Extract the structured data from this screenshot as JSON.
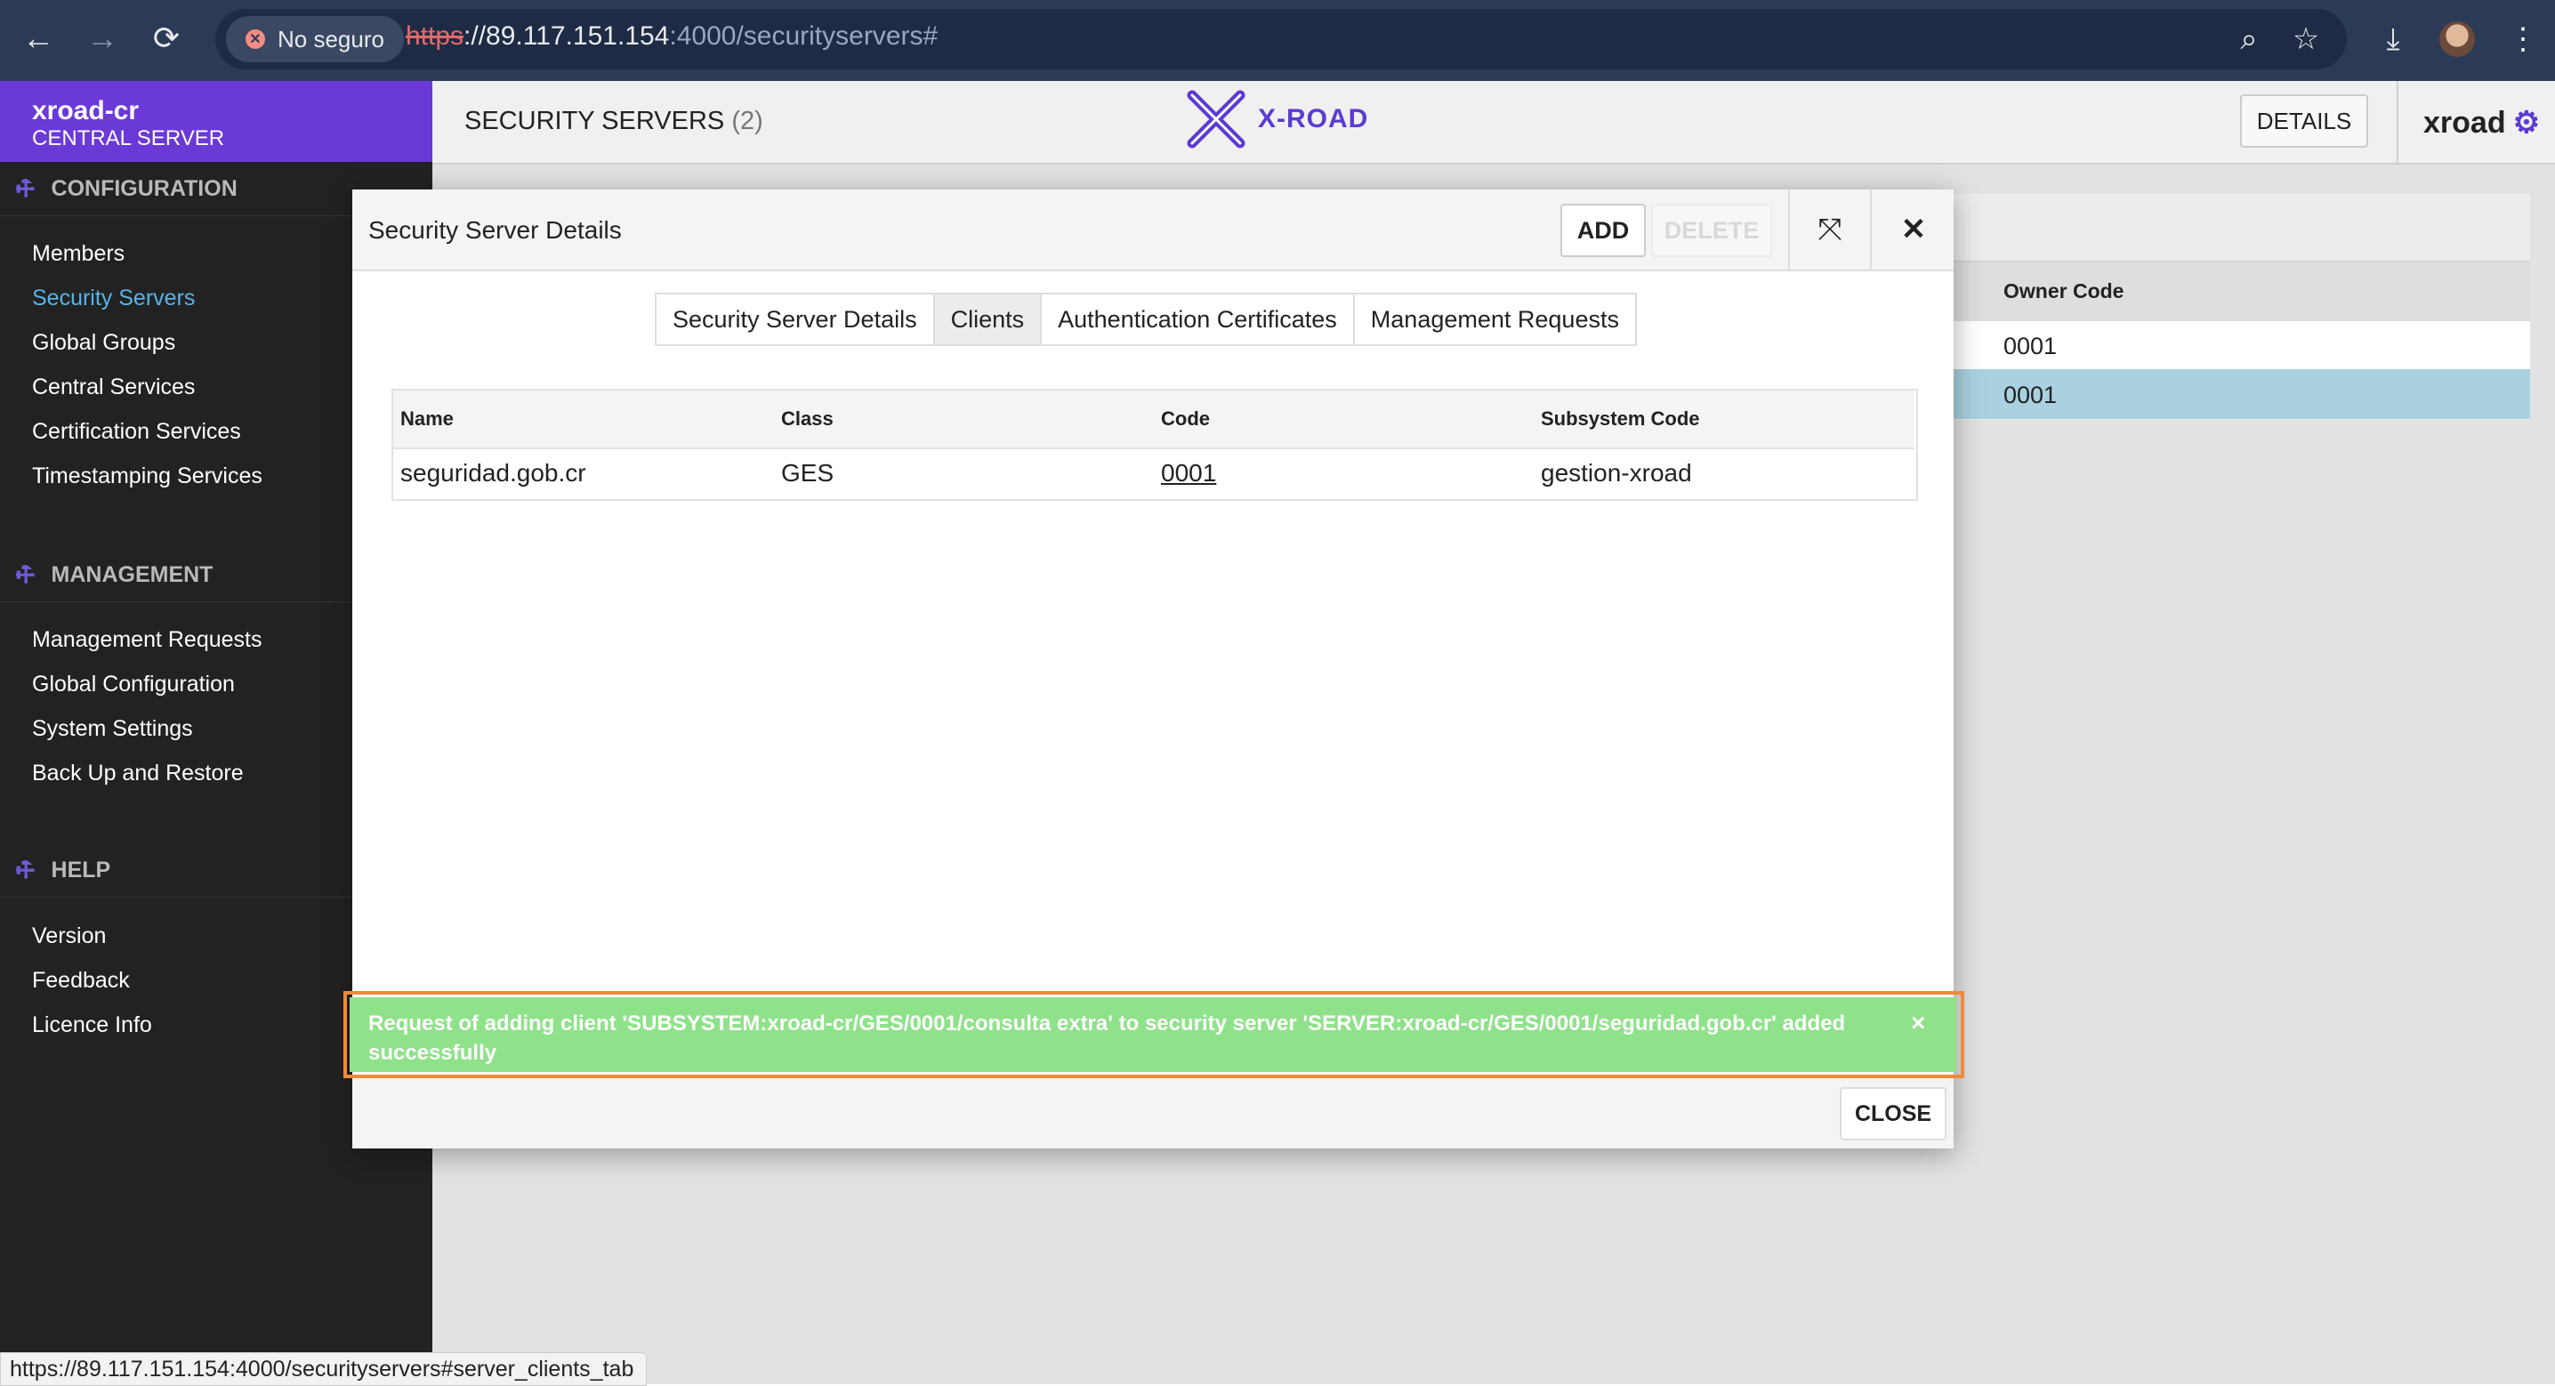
{
  "browser": {
    "security_label": "No seguro",
    "url_scheme": "https",
    "url_host": "://89.117.151.154",
    "url_rest": ":4000/securityservers#",
    "status_url": "https://89.117.151.154:4000/securityservers#server_clients_tab"
  },
  "brand": {
    "instance": "xroad-cr",
    "subtitle": "CENTRAL SERVER"
  },
  "sidebar": {
    "sections": [
      {
        "title": "CONFIGURATION",
        "items": [
          "Members",
          "Security Servers",
          "Global Groups",
          "Central Services",
          "Certification Services",
          "Timestamping Services"
        ]
      },
      {
        "title": "MANAGEMENT",
        "items": [
          "Management Requests",
          "Global Configuration",
          "System Settings",
          "Back Up and Restore"
        ]
      },
      {
        "title": "HELP",
        "items": [
          "Version",
          "Feedback",
          "Licence Info"
        ]
      }
    ],
    "active_item": "Security Servers"
  },
  "header": {
    "title": "SECURITY SERVERS",
    "count": "(2)",
    "logo_text": "X-ROAD",
    "details_label": "DETAILS",
    "user": "xroad"
  },
  "background_table": {
    "column": "Owner Code",
    "rows": [
      "0001",
      "0001"
    ]
  },
  "dialog": {
    "title": "Security Server Details",
    "add_label": "ADD",
    "delete_label": "DELETE",
    "tabs": [
      "Security Server Details",
      "Clients",
      "Authentication Certificates",
      "Management Requests"
    ],
    "active_tab": "Clients",
    "table": {
      "columns": [
        "Name",
        "Class",
        "Code",
        "Subsystem Code"
      ],
      "rows": [
        [
          "seguridad.gob.cr",
          "GES",
          "0001",
          "gestion-xroad"
        ]
      ]
    },
    "notification": "Request of adding client 'SUBSYSTEM:xroad-cr/GES/0001/consulta extra' to security server 'SERVER:xroad-cr/GES/0001/seguridad.gob.cr' added successfully",
    "notification_close": "×",
    "close_label": "CLOSE"
  },
  "colors": {
    "brand": "#6b39d6",
    "sidebar": "#222222",
    "active_nav": "#58b3e8",
    "notification": "#8fe28a",
    "highlight_border": "#f08a3a",
    "selected_row": "#a9d1df"
  }
}
